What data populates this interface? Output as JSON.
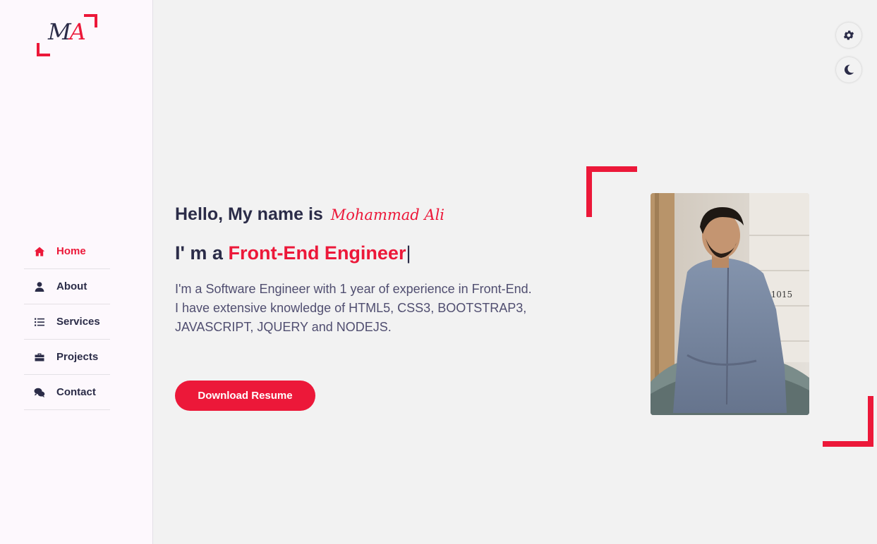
{
  "logo": {
    "letter_m": "M",
    "letter_a": "A"
  },
  "nav": {
    "items": [
      {
        "label": "Home",
        "icon": "home-icon",
        "active": true
      },
      {
        "label": "About",
        "icon": "user-icon",
        "active": false
      },
      {
        "label": "Services",
        "icon": "list-icon",
        "active": false
      },
      {
        "label": "Projects",
        "icon": "briefcase-icon",
        "active": false
      },
      {
        "label": "Contact",
        "icon": "comments-icon",
        "active": false
      }
    ]
  },
  "controls": {
    "settings_icon": "gear-icon",
    "theme_icon": "moon-icon"
  },
  "hero": {
    "greeting_prefix": "Hello, My name is",
    "name": "Mohammad Ali",
    "role_prefix": "I' m a",
    "role": "Front-End Engineer",
    "cursor": "|",
    "bio_lines": [
      "I'm a Software Engineer with 1 year of experience in Front-End.",
      "I have extensive knowledge of HTML5, CSS3, BOOTSTRAP3,",
      "JAVASCRIPT, JQUERY and NODEJS."
    ],
    "download_label": "Download Resume",
    "photo_house_number": "21015"
  },
  "colors": {
    "accent": "#ec1839",
    "text": "#2b2c48",
    "background": "#f2f2f2",
    "sidebar": "#fdf8fd"
  }
}
